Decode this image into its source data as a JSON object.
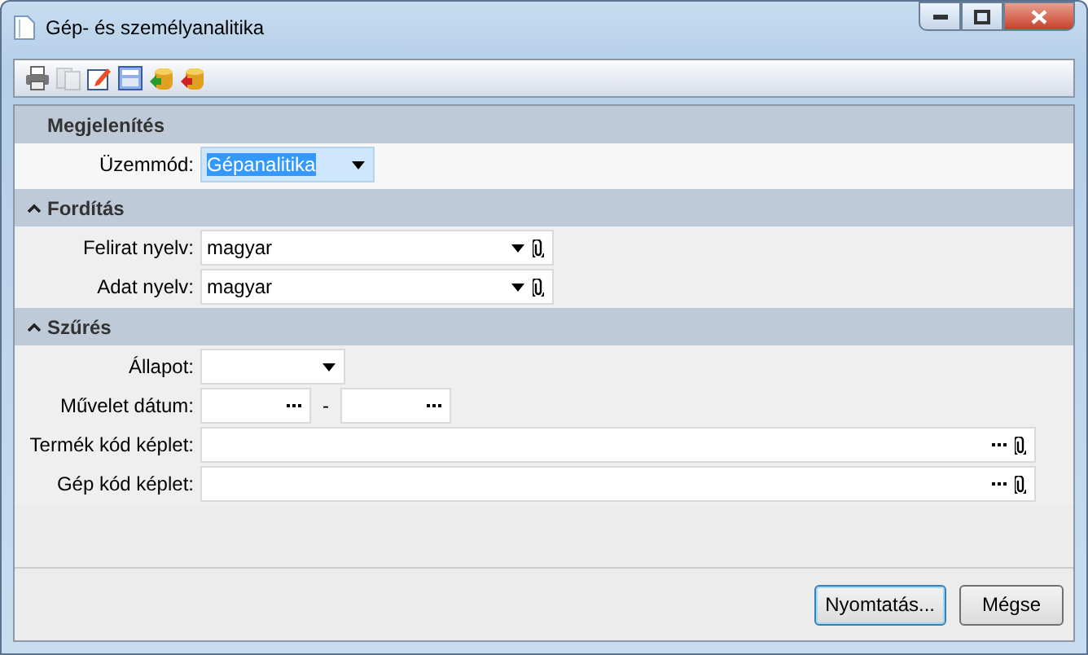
{
  "window": {
    "title": "Gép- és személyanalitika"
  },
  "toolbar": [
    {
      "disabled": false
    },
    {
      "disabled": true
    },
    {
      "disabled": false
    },
    {
      "disabled": false
    },
    {
      "disabled": false
    },
    {
      "disabled": false
    }
  ],
  "sections": [
    {
      "title": "Megjelenítés",
      "collapsible": false,
      "rows": [
        {
          "kind": "mode_select",
          "label": "Üzemmód:",
          "value": "Gépanalitika",
          "highlighted": true
        }
      ]
    },
    {
      "title": "Fordítás",
      "collapsible": true,
      "rows": [
        {
          "kind": "lookup",
          "label": "Felirat nyelv:",
          "value": "magyar"
        },
        {
          "kind": "lookup",
          "label": "Adat nyelv:",
          "value": "magyar"
        }
      ]
    },
    {
      "title": "Szűrés",
      "collapsible": true,
      "rows": [
        {
          "kind": "dropdown",
          "label": "Állapot:"
        },
        {
          "kind": "date_range",
          "label": "Művelet dátum:",
          "separator": "-"
        },
        {
          "kind": "formula",
          "label": "Termék kód képlet:"
        },
        {
          "kind": "formula",
          "label": "Gép kód képlet:"
        }
      ]
    }
  ],
  "buttons": [
    {
      "label": "Nyomtatás...",
      "default": true
    },
    {
      "label": "Mégse",
      "default": false
    }
  ]
}
